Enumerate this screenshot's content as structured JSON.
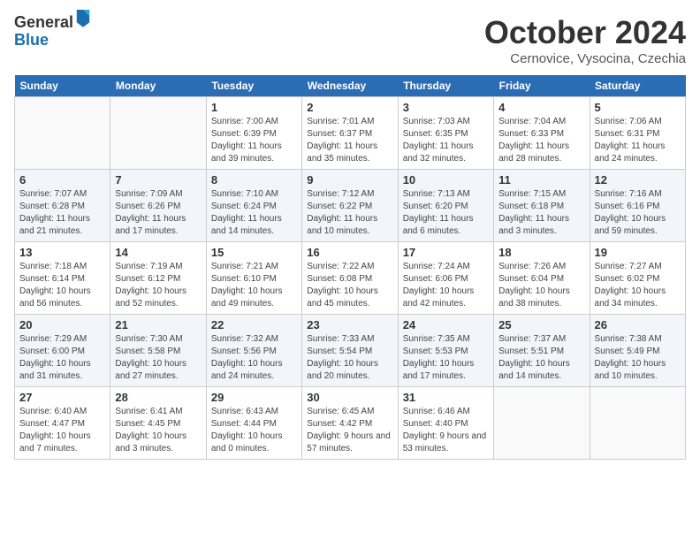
{
  "header": {
    "logo_line1": "General",
    "logo_line2": "Blue",
    "month": "October 2024",
    "location": "Cernovice, Vysocina, Czechia"
  },
  "days_of_week": [
    "Sunday",
    "Monday",
    "Tuesday",
    "Wednesday",
    "Thursday",
    "Friday",
    "Saturday"
  ],
  "weeks": [
    [
      {
        "day": "",
        "info": ""
      },
      {
        "day": "",
        "info": ""
      },
      {
        "day": "1",
        "info": "Sunrise: 7:00 AM\nSunset: 6:39 PM\nDaylight: 11 hours and 39 minutes."
      },
      {
        "day": "2",
        "info": "Sunrise: 7:01 AM\nSunset: 6:37 PM\nDaylight: 11 hours and 35 minutes."
      },
      {
        "day": "3",
        "info": "Sunrise: 7:03 AM\nSunset: 6:35 PM\nDaylight: 11 hours and 32 minutes."
      },
      {
        "day": "4",
        "info": "Sunrise: 7:04 AM\nSunset: 6:33 PM\nDaylight: 11 hours and 28 minutes."
      },
      {
        "day": "5",
        "info": "Sunrise: 7:06 AM\nSunset: 6:31 PM\nDaylight: 11 hours and 24 minutes."
      }
    ],
    [
      {
        "day": "6",
        "info": "Sunrise: 7:07 AM\nSunset: 6:28 PM\nDaylight: 11 hours and 21 minutes."
      },
      {
        "day": "7",
        "info": "Sunrise: 7:09 AM\nSunset: 6:26 PM\nDaylight: 11 hours and 17 minutes."
      },
      {
        "day": "8",
        "info": "Sunrise: 7:10 AM\nSunset: 6:24 PM\nDaylight: 11 hours and 14 minutes."
      },
      {
        "day": "9",
        "info": "Sunrise: 7:12 AM\nSunset: 6:22 PM\nDaylight: 11 hours and 10 minutes."
      },
      {
        "day": "10",
        "info": "Sunrise: 7:13 AM\nSunset: 6:20 PM\nDaylight: 11 hours and 6 minutes."
      },
      {
        "day": "11",
        "info": "Sunrise: 7:15 AM\nSunset: 6:18 PM\nDaylight: 11 hours and 3 minutes."
      },
      {
        "day": "12",
        "info": "Sunrise: 7:16 AM\nSunset: 6:16 PM\nDaylight: 10 hours and 59 minutes."
      }
    ],
    [
      {
        "day": "13",
        "info": "Sunrise: 7:18 AM\nSunset: 6:14 PM\nDaylight: 10 hours and 56 minutes."
      },
      {
        "day": "14",
        "info": "Sunrise: 7:19 AM\nSunset: 6:12 PM\nDaylight: 10 hours and 52 minutes."
      },
      {
        "day": "15",
        "info": "Sunrise: 7:21 AM\nSunset: 6:10 PM\nDaylight: 10 hours and 49 minutes."
      },
      {
        "day": "16",
        "info": "Sunrise: 7:22 AM\nSunset: 6:08 PM\nDaylight: 10 hours and 45 minutes."
      },
      {
        "day": "17",
        "info": "Sunrise: 7:24 AM\nSunset: 6:06 PM\nDaylight: 10 hours and 42 minutes."
      },
      {
        "day": "18",
        "info": "Sunrise: 7:26 AM\nSunset: 6:04 PM\nDaylight: 10 hours and 38 minutes."
      },
      {
        "day": "19",
        "info": "Sunrise: 7:27 AM\nSunset: 6:02 PM\nDaylight: 10 hours and 34 minutes."
      }
    ],
    [
      {
        "day": "20",
        "info": "Sunrise: 7:29 AM\nSunset: 6:00 PM\nDaylight: 10 hours and 31 minutes."
      },
      {
        "day": "21",
        "info": "Sunrise: 7:30 AM\nSunset: 5:58 PM\nDaylight: 10 hours and 27 minutes."
      },
      {
        "day": "22",
        "info": "Sunrise: 7:32 AM\nSunset: 5:56 PM\nDaylight: 10 hours and 24 minutes."
      },
      {
        "day": "23",
        "info": "Sunrise: 7:33 AM\nSunset: 5:54 PM\nDaylight: 10 hours and 20 minutes."
      },
      {
        "day": "24",
        "info": "Sunrise: 7:35 AM\nSunset: 5:53 PM\nDaylight: 10 hours and 17 minutes."
      },
      {
        "day": "25",
        "info": "Sunrise: 7:37 AM\nSunset: 5:51 PM\nDaylight: 10 hours and 14 minutes."
      },
      {
        "day": "26",
        "info": "Sunrise: 7:38 AM\nSunset: 5:49 PM\nDaylight: 10 hours and 10 minutes."
      }
    ],
    [
      {
        "day": "27",
        "info": "Sunrise: 6:40 AM\nSunset: 4:47 PM\nDaylight: 10 hours and 7 minutes."
      },
      {
        "day": "28",
        "info": "Sunrise: 6:41 AM\nSunset: 4:45 PM\nDaylight: 10 hours and 3 minutes."
      },
      {
        "day": "29",
        "info": "Sunrise: 6:43 AM\nSunset: 4:44 PM\nDaylight: 10 hours and 0 minutes."
      },
      {
        "day": "30",
        "info": "Sunrise: 6:45 AM\nSunset: 4:42 PM\nDaylight: 9 hours and 57 minutes."
      },
      {
        "day": "31",
        "info": "Sunrise: 6:46 AM\nSunset: 4:40 PM\nDaylight: 9 hours and 53 minutes."
      },
      {
        "day": "",
        "info": ""
      },
      {
        "day": "",
        "info": ""
      }
    ]
  ]
}
